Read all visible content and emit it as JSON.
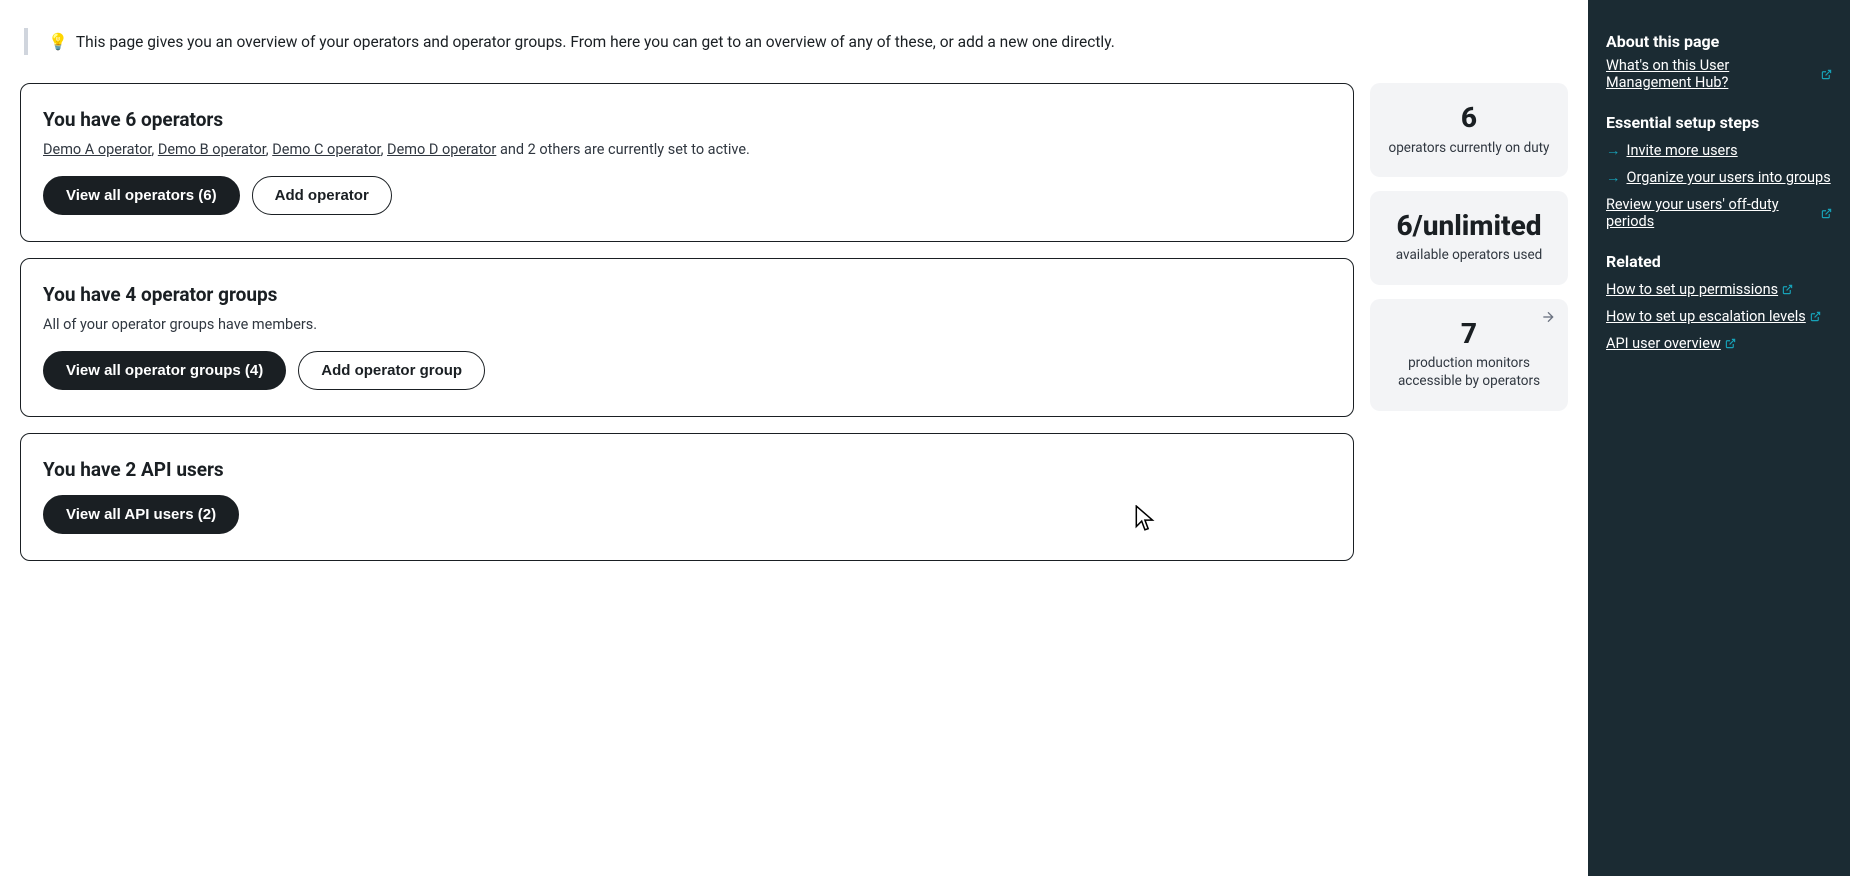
{
  "tip": {
    "icon": "lightbulb-icon",
    "text": "This page gives you an overview of your operators and operator groups. From here you can get to an overview of any of these, or add a new one directly."
  },
  "operators_card": {
    "heading": "You have 6 operators",
    "links": [
      "Demo A operator",
      "Demo B operator",
      "Demo C operator",
      "Demo D operator"
    ],
    "trailing": " and 2 others are currently set to active.",
    "view_btn": "View all operators (6)",
    "add_btn": "Add operator"
  },
  "groups_card": {
    "heading": "You have 4 operator groups",
    "desc": "All of your operator groups have members.",
    "view_btn": "View all operator groups (4)",
    "add_btn": "Add operator group"
  },
  "api_card": {
    "heading": "You have 2 API users",
    "view_btn": "View all API users (2)"
  },
  "stats": {
    "on_duty_num": "6",
    "on_duty_label": "operators currently on duty",
    "avail_num": "6/unlimited",
    "avail_label": "available operators used",
    "monitors_num": "7",
    "monitors_label": "production monitors accessible by operators"
  },
  "sidebar": {
    "about_heading": "About this page",
    "about_link": "What's on this User Management Hub?",
    "steps_heading": "Essential setup steps",
    "step1": "Invite more users",
    "step2": "Organize your users into groups",
    "step3": "Review your users' off-duty periods",
    "related_heading": "Related",
    "rel1": "How to set up permissions",
    "rel2": "How to set up escalation levels",
    "rel3": "API user overview"
  }
}
